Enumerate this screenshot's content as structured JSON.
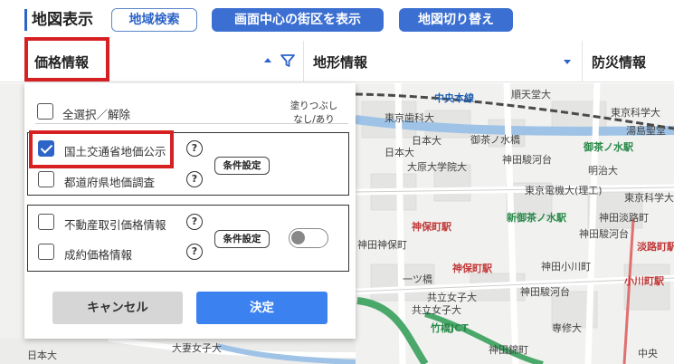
{
  "toolbar": {
    "title": "地図表示",
    "area_search": "地域検索",
    "show_center_block": "画面中心の街区を表示",
    "switch_map": "地図切り替え"
  },
  "tabs": {
    "price": "価格情報",
    "terrain": "地形情報",
    "disaster": "防災情報"
  },
  "panel": {
    "select_all": "全選択／解除",
    "fill_caption_line1": "塗りつぶし",
    "fill_caption_line2": "なし/あり",
    "group1": {
      "item1": "国土交通省地価公示",
      "item1_checked": true,
      "item2": "都道府県地価調査",
      "item2_checked": false,
      "condition": "条件設定"
    },
    "group2": {
      "item1": "不動産取引価格情報",
      "item2": "成約価格情報",
      "condition": "条件設定",
      "toggle_on": false
    },
    "cancel": "キャンセル",
    "ok": "決定",
    "help_symbol": "?"
  },
  "map": {
    "labels": {
      "chuo_line": "中央本線",
      "ochanomizu_stn": "御茶ノ水駅",
      "shin_ochanomizu_stn": "新御茶ノ水駅",
      "jimbocho_stn": "神保町駅",
      "jimbocho_stn2": "神保町駅",
      "awajicho_stn": "淡路町駅",
      "ogawamachi_stn": "小川町駅",
      "takebashi_jct": "竹橋JCT",
      "surugadai3": "神田駿河台",
      "surugadai2": "神田駿河台",
      "surugadai4": "神田駿河台",
      "jimbocho2": "神田神保町",
      "ogawamachi": "神田小川町",
      "awajicho": "神田淡路町",
      "nishikicho": "神田錦町",
      "nihon_univ": "日本大",
      "nihon_univ2": "日本大",
      "daito_bunka": "大原大学院大",
      "juntendo": "順天堂大",
      "tokyo_ika": "東京歯科大",
      "tokyo_kagaku": "東京科学大",
      "tokyo_kagaku2": "東京科学大",
      "yushima": "湯島聖堂",
      "ochanomizu_bridge": "御茶ノ水橋",
      "hitotsubashi": "一ツ橋",
      "kyoritsu": "共立女子大",
      "kyoritsu2": "共立女子大",
      "senshu": "専修大",
      "meiji": "明治大",
      "tokyo_denki": "東京電機大(理工)",
      "nihon_univ_bottom": "日本大",
      "otsuma": "大妻女子大",
      "chuo": "中央"
    }
  }
}
